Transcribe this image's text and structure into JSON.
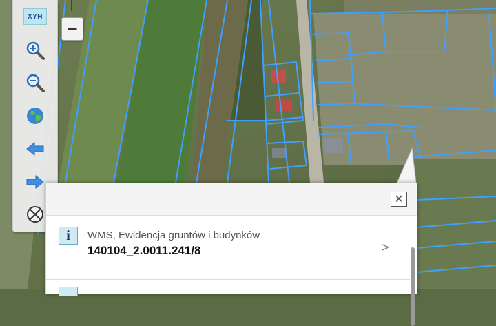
{
  "toolbar": {
    "xyh_label": "XYH",
    "tools": [
      {
        "icon": "xyh-icon"
      },
      {
        "icon": "zoom-in-icon"
      },
      {
        "icon": "zoom-out-icon"
      },
      {
        "icon": "globe-icon"
      },
      {
        "icon": "arrow-left-icon"
      },
      {
        "icon": "arrow-right-icon"
      },
      {
        "icon": "target-icon"
      }
    ]
  },
  "zoom": {
    "minus_label": "−"
  },
  "popup": {
    "close_label": "✕",
    "results": [
      {
        "layer": "WMS, Ewidencja gruntów i budynków",
        "parcel_id": "140104_2.0011.241/8",
        "icon_label": "i"
      }
    ]
  },
  "colors": {
    "parcel_outline": "#3fa0ff",
    "info_icon_bg": "#cfeaf2"
  }
}
